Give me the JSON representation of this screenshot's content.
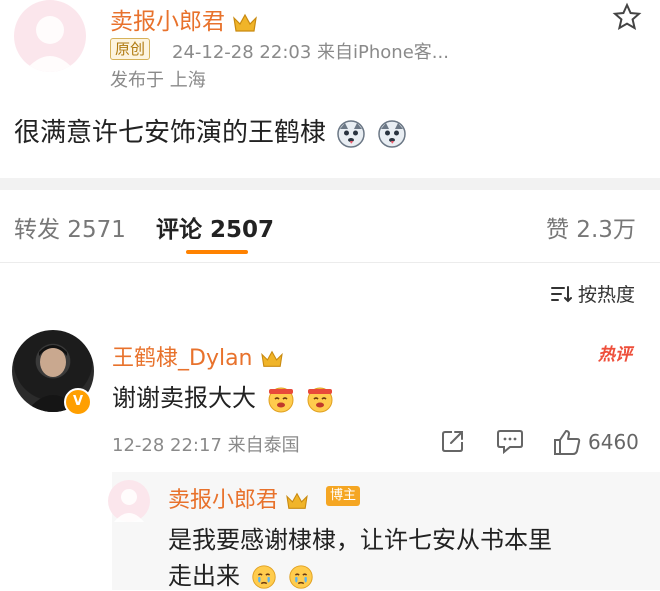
{
  "post": {
    "author": "卖报小郎君",
    "badge": "原创",
    "meta": "24-12-28 22:03  来自iPhone客...",
    "location": "发布于 上海",
    "text": "很满意许七安饰演的王鹤棣",
    "emoji_icons": [
      "husky-face-icon",
      "husky-face-icon"
    ]
  },
  "tabs": [
    {
      "label": "转发 2571",
      "active": false
    },
    {
      "label": "评论 2507",
      "active": true
    },
    {
      "label": "赞 2.3万",
      "active": false
    }
  ],
  "sort": {
    "label": "按热度"
  },
  "comment": {
    "author": "王鹤棣_Dylan",
    "hot_label": "热评",
    "text": "谢谢卖报大大",
    "emoji_icons": [
      "cheering-face-icon",
      "cheering-face-icon"
    ],
    "meta": "12-28 22:17  来自泰国",
    "likes": "6460"
  },
  "reply": {
    "author": "卖报小郎君",
    "tag": "博主",
    "text_line1": "是我要感谢棣棣，让许七安从书本里",
    "text_line2": "走出来",
    "emoji_icons": [
      "teary-face-icon",
      "teary-face-icon"
    ]
  },
  "colors": {
    "username": "#e8722c",
    "accent": "#ff8200",
    "meta": "#8a8a8a",
    "hot": "#ee4e3a"
  }
}
